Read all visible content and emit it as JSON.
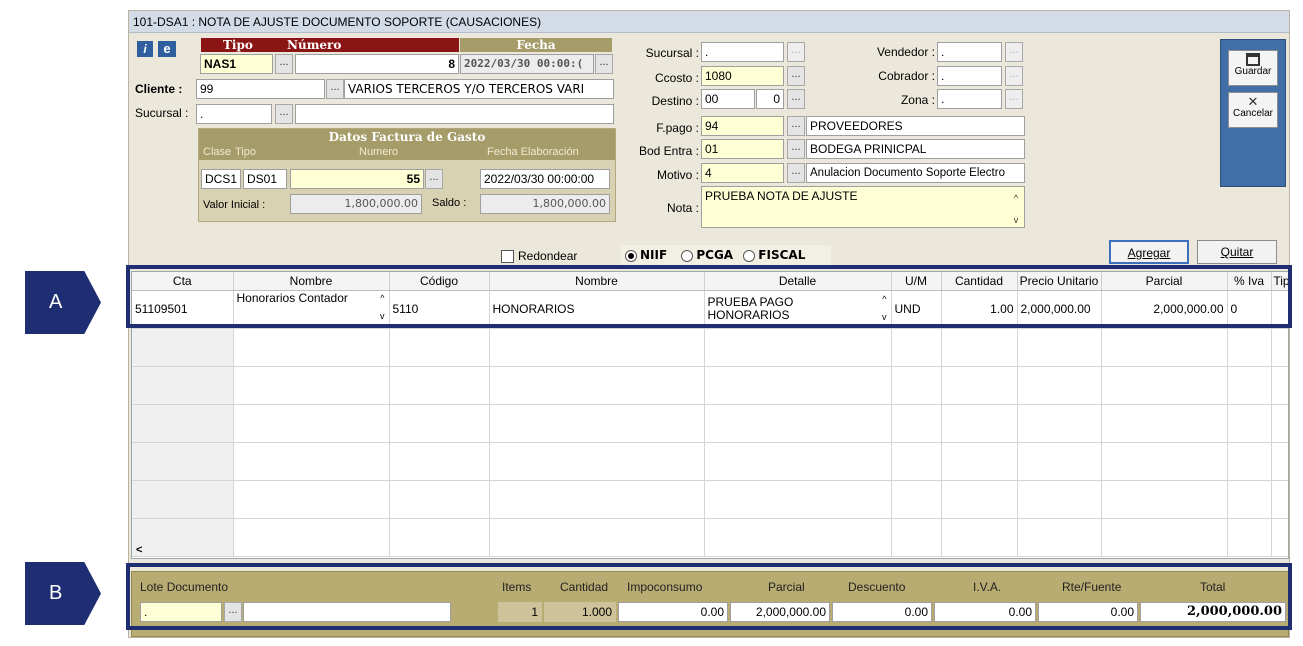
{
  "window": {
    "title": "101-DSA1 : NOTA DE AJUSTE DOCUMENTO SOPORTE (CAUSACIONES)"
  },
  "header": {
    "tipo_label": "Tipo",
    "numero_label": "Número",
    "fecha_label": "Fecha",
    "tipo_value": "NAS1",
    "numero_value": "8",
    "fecha_value": "2022/03/30 00:00:(",
    "cliente_label": "Cliente :",
    "cliente_code": "99",
    "cliente_name": "VARIOS TERCEROS Y/O TERCEROS VARI",
    "sucursal_label": "Sucursal :",
    "sucursal_value": ".",
    "ellipsis": "..."
  },
  "factura": {
    "title": "Datos Factura de Gasto",
    "clase_label": "Clase",
    "tipo_label": "Tipo",
    "numero_label": "Numero",
    "fecha_label": "Fecha Elaboración",
    "clase_value": "DCS1",
    "tipo_value": "DS01",
    "numero_value": "55",
    "fecha_value": "2022/03/30 00:00:00",
    "valor_inicial_label": "Valor Inicial :",
    "valor_inicial": "1,800,000.00",
    "saldo_label": "Saldo :",
    "saldo": "1,800,000.00"
  },
  "middle": {
    "sucursal_label": "Sucursal :",
    "sucursal_value": ".",
    "ccosto_label": "Ccosto :",
    "ccosto_value": "1080",
    "destino_label": "Destino :",
    "destino_value": "00",
    "destino_num": "0",
    "fpago_label": "F.pago :",
    "fpago_code": "94",
    "fpago_desc": "PROVEEDORES",
    "bodentra_label": "Bod Entra :",
    "bodentra_code": "01",
    "bodentra_desc": "BODEGA PRINICPAL",
    "motivo_label": "Motivo :",
    "motivo_code": "4",
    "motivo_desc": "Anulacion Documento Soporte Electro",
    "nota_label": "Nota :",
    "nota_value": "PRUEBA NOTA DE AJUSTE"
  },
  "right": {
    "vendedor_label": "Vendedor :",
    "vendedor_value": ".",
    "cobrador_label": "Cobrador :",
    "cobrador_value": ".",
    "zona_label": "Zona :",
    "zona_value": "."
  },
  "side": {
    "guardar": "Guardar",
    "cancelar": "Cancelar"
  },
  "options": {
    "redondear": "Redondear",
    "niif": "NIIF",
    "pcga": "PCGA",
    "fiscal": "FISCAL",
    "agregar": "Agregar",
    "quitar": "Quitar"
  },
  "grid": {
    "columns": [
      "Cta",
      "Nombre",
      "Código",
      "Nombre",
      "Detalle",
      "U/M",
      "Cantidad",
      "Precio Unitario",
      "Parcial",
      "% Iva",
      "Tip"
    ],
    "row": {
      "cta": "51109501",
      "nombre": "Honorarios Contador",
      "codigo": "5110",
      "nombre2": "HONORARIOS",
      "detalle": "PRUEBA PAGO HONORARIOS",
      "um": "UND",
      "cantidad": "1.00",
      "precio": "2,000,000.00",
      "parcial": "2,000,000.00",
      "iva": "0"
    },
    "scroll_left": "<"
  },
  "footer": {
    "lote_label": "Lote Documento",
    "lote_value": ".",
    "items_label": "Items",
    "items_value": "1",
    "cantidad_label": "Cantidad",
    "cantidad_value": "1.000",
    "impoconsumo_label": "Impoconsumo",
    "impoconsumo_value": "0.00",
    "parcial_label": "Parcial",
    "parcial_value": "2,000,000.00",
    "descuento_label": "Descuento",
    "descuento_value": "0.00",
    "iva_label": "I.V.A.",
    "iva_value": "0.00",
    "rtefuente_label": "Rte/Fuente",
    "rtefuente_value": "0.00",
    "total_label": "Total",
    "total_value": "2,000,000.00"
  },
  "annotations": {
    "a": "A",
    "b": "B",
    "color": "#1f2e73"
  }
}
